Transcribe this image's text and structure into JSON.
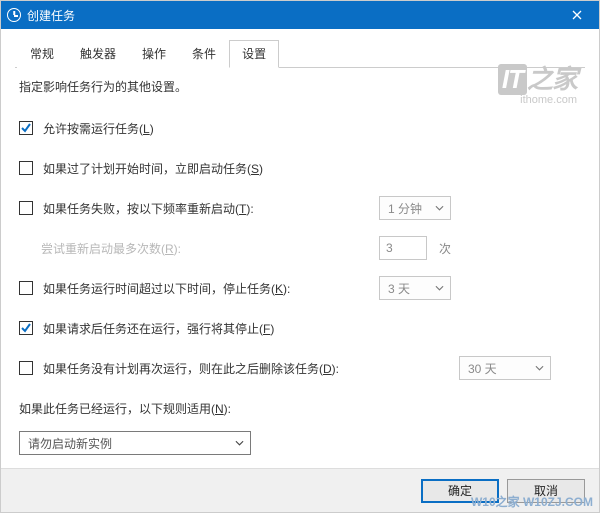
{
  "window": {
    "title": "创建任务",
    "close": "×"
  },
  "watermark": {
    "brand_prefix": "IT",
    "brand_suffix": "之家",
    "url": "ithome.com",
    "bottom": "W10之家 W10ZJ.COM"
  },
  "tabs": {
    "general": "常规",
    "triggers": "触发器",
    "actions": "操作",
    "conditions": "条件",
    "settings": "设置"
  },
  "settings": {
    "description": "指定影响任务行为的其他设置。",
    "allow_on_demand": "允许按需运行任务(",
    "allow_on_demand_key": "L",
    "allow_on_demand_suffix": ")",
    "run_if_missed": "如果过了计划开始时间，立即启动任务(",
    "run_if_missed_key": "S",
    "run_if_missed_suffix": ")",
    "restart_on_fail": "如果任务失败，按以下频率重新启动(",
    "restart_on_fail_key": "T",
    "restart_on_fail_suffix": "):",
    "restart_interval": "1 分钟",
    "max_restarts_label": "尝试重新启动最多次数(",
    "max_restarts_key": "R",
    "max_restarts_suffix": "):",
    "max_restarts_value": "3",
    "max_restarts_unit": "次",
    "stop_if_long": "如果任务运行时间超过以下时间，停止任务(",
    "stop_if_long_key": "K",
    "stop_if_long_suffix": "):",
    "stop_duration": "3 天",
    "force_stop": "如果请求后任务还在运行，强行将其停止(",
    "force_stop_key": "F",
    "force_stop_suffix": ")",
    "delete_if_not_scheduled": "如果任务没有计划再次运行，则在此之后删除该任务(",
    "delete_if_not_scheduled_key": "D",
    "delete_if_not_scheduled_suffix": "):",
    "delete_after": "30 天",
    "rule_label": "如果此任务已经运行，以下规则适用(",
    "rule_label_key": "N",
    "rule_label_suffix": "):",
    "rule_value": "请勿启动新实例"
  },
  "buttons": {
    "ok": "确定",
    "cancel": "取消"
  }
}
